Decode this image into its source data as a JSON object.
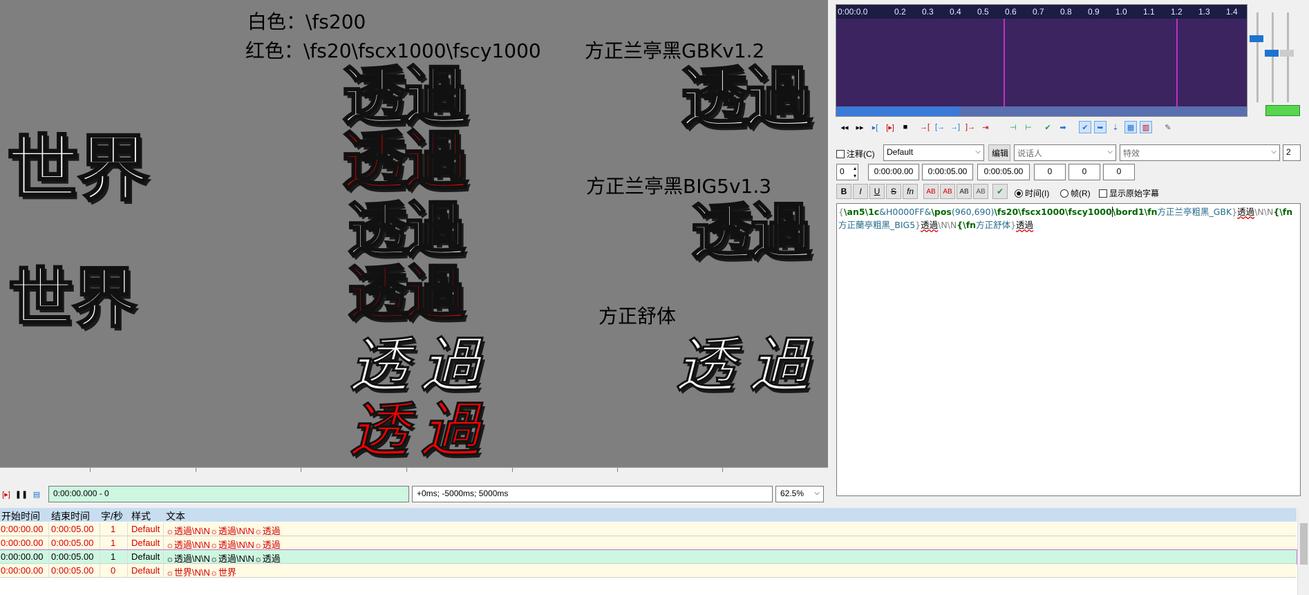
{
  "video": {
    "label_white": "白色：\\fs200",
    "label_red": "红色：\\fs20\\fscx1000\\fscy1000",
    "label_font1": "方正兰亭黑GBKv1.2",
    "label_font2": "方正兰亭黑BIG5v1.3",
    "label_font3": "方正舒体",
    "glyph_touguo": "透過",
    "glyph_shijie": "世界"
  },
  "video_bar": {
    "time": "0:00:00.000 - 0",
    "offset": "+0ms; -5000ms; 5000ms",
    "zoom": "62.5%"
  },
  "audio": {
    "ticks": [
      "0:00:0.0",
      "0.2",
      "0.3",
      "0.4",
      "0.5",
      "0.6",
      "0.7",
      "0.8",
      "0.9",
      "1.0",
      "1.1",
      "1.2",
      "1.3",
      "1.4"
    ],
    "progress_fraction": 0.3
  },
  "edit": {
    "comment_label": "注释(C)",
    "style": "Default",
    "edit_btn": "编辑",
    "actor_placeholder": "说话人",
    "effect_placeholder": "特效",
    "line_count": "2",
    "layer": "0",
    "start": "0:00:00.00",
    "end": "0:00:05.00",
    "duration": "0:00:05.00",
    "margin_l": "0",
    "margin_r": "0",
    "margin_v": "0",
    "time_radio": "时间(I)",
    "frame_radio": "帧(R)",
    "show_original": "显示原始字幕",
    "format_buttons": [
      "B",
      "I",
      "U",
      "S",
      "fn",
      "AB",
      "AB",
      "AB",
      "AB"
    ]
  },
  "script": {
    "line1_a": "{",
    "line1_tags": [
      {
        "t": "\\an5\\1c",
        "k": "tag"
      },
      {
        "t": "&H0000FF&",
        "k": "par"
      },
      {
        "t": "\\pos",
        "k": "tag"
      },
      {
        "t": "(960,690)",
        "k": "par"
      },
      {
        "t": "\\fs20",
        "k": "tag"
      },
      {
        "t": "\\fscx1000\\fscy1000",
        "k": "tag"
      },
      {
        "t": "\\bord1\\fn",
        "k": "tag"
      },
      {
        "t": "方正兰亭粗黑_GBK",
        "k": "par"
      }
    ],
    "line1_b": "}",
    "line1_text": "透過",
    "nl": "\\N\\N",
    "fn2_tag": "{\\fn",
    "fn2_name": "方正蘭亭粗黑_BIG5",
    "fn2_close": "}",
    "line2_text": "透過",
    "nl2": "\\N\\N",
    "fn3_tag": "{\\fn",
    "fn3_name": "方正舒体",
    "fn3_close": "}",
    "line3_text": "透過"
  },
  "grid": {
    "headers": [
      "开始时间",
      "结束时间",
      "字/秒",
      "样式",
      "文本"
    ],
    "rows": [
      {
        "start": "0:00:00.00",
        "end": "0:00:05.00",
        "cps": "1",
        "style": "Default",
        "text": "☼透過\\N\\N☼透過\\N\\N☼透過",
        "bg": "#fffbe4",
        "color": "#d40000"
      },
      {
        "start": "0:00:00.00",
        "end": "0:00:05.00",
        "cps": "1",
        "style": "Default",
        "text": "☼透過\\N\\N☼透過\\N\\N☼透過",
        "bg": "#fffbe4",
        "color": "#d40000"
      },
      {
        "start": "0:00:00.00",
        "end": "0:00:05.00",
        "cps": "1",
        "style": "Default",
        "text": "☼透過\\N\\N☼透過\\N\\N☼透過",
        "bg": "#cdf7e1",
        "color": "#000000"
      },
      {
        "start": "0:00:00.00",
        "end": "0:00:05.00",
        "cps": "0",
        "style": "Default",
        "text": "☼世界\\N\\N☼世界",
        "bg": "#fffbe4",
        "color": "#d40000"
      }
    ]
  },
  "colors": {
    "video_bg": "#7f7f7f",
    "audio_bg": "#3b2460",
    "tag": "#006600",
    "param": "#246b8c",
    "selected_row": "#cdf7e1",
    "error_row_text": "#d40000"
  }
}
